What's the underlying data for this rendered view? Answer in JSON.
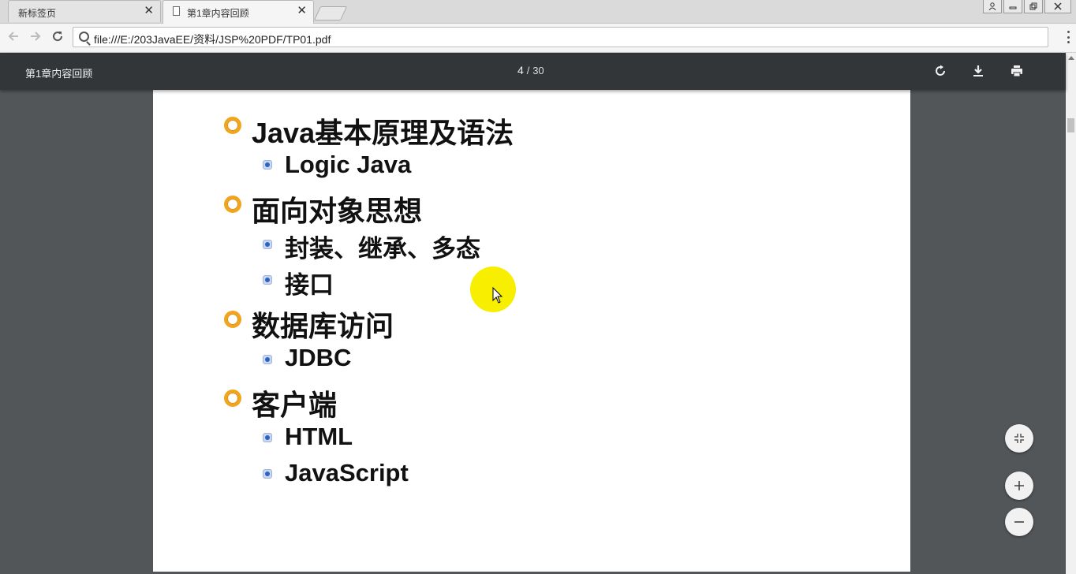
{
  "browser": {
    "tabs": [
      {
        "label": "新标签页",
        "active": false
      },
      {
        "label": "第1章内容回顾",
        "active": true
      }
    ],
    "address": "file:///E:/203JavaEE/资料/JSP%20PDF/TP01.pdf",
    "close_glyph": "✕"
  },
  "pdf": {
    "title": "第1章内容回顾",
    "current_page": "4",
    "separator": "/",
    "total_pages": "30"
  },
  "slide": {
    "items": [
      {
        "level": 1,
        "text": "Java基本原理及语法"
      },
      {
        "level": 2,
        "text": "Logic Java"
      },
      {
        "level": 1,
        "text": "面向对象思想"
      },
      {
        "level": 2,
        "text": "封装、继承、多态"
      },
      {
        "level": 2,
        "text": "接口"
      },
      {
        "level": 1,
        "text": "数据库访问"
      },
      {
        "level": 2,
        "text": "JDBC"
      },
      {
        "level": 1,
        "text": "客户端"
      },
      {
        "level": 2,
        "text": "HTML"
      },
      {
        "level": 2,
        "text": "JavaScript"
      }
    ]
  },
  "colors": {
    "pdf_toolbar": "#323639",
    "viewer_bg": "#525659",
    "bullet_orange": "#f1a51c",
    "bullet_blue": "#2b62c4",
    "cursor_highlight": "#f7ee00"
  },
  "icons": {
    "rotate": "rotate-icon",
    "download": "download-icon",
    "print": "print-icon",
    "fit": "fit-page-icon",
    "zoom_in": "zoom-in-icon",
    "zoom_out": "zoom-out-icon"
  }
}
